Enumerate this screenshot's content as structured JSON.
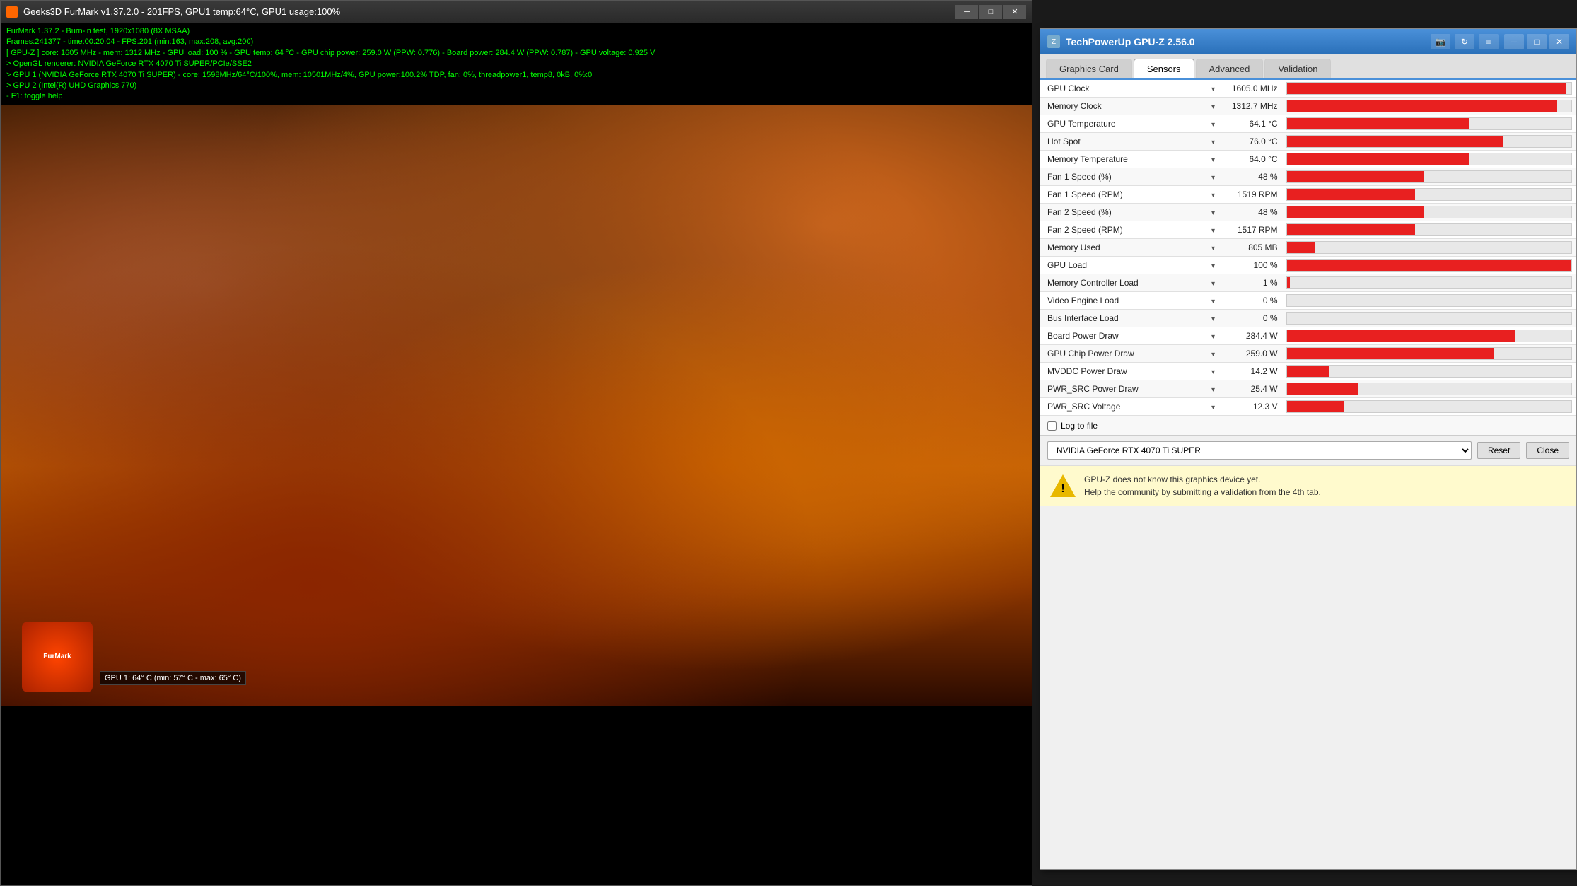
{
  "furmark": {
    "title": "Geeks3D FurMark v1.37.2.0 - 201FPS, GPU1 temp:64°C, GPU1 usage:100%",
    "info_lines": [
      "FurMark 1.37.2 - Burn-in test, 1920x1080 (8X MSAA)",
      "Frames:241377 - time:00:20:04 - FPS:201 (min:163, max:208, avg:200)",
      "[ GPU-Z ] core: 1605 MHz - mem: 1312 MHz - GPU load: 100 % - GPU temp: 64 °C - GPU chip power: 259.0 W (PPW: 0.776) - Board power: 284.4 W (PPW: 0.787) - GPU voltage: 0.925 V",
      "> OpenGL renderer: NVIDIA GeForce RTX 4070 Ti SUPER/PCIe/SSE2",
      "> GPU 1 (NVIDIA GeForce RTX 4070 Ti SUPER) - core: 1598MHz/64°C/100%, mem: 10501MHz/4%, GPU power:100.2% TDP, fan: 0%, threadpower1, temp8, 0kB, 0%:0",
      "> GPU 2 (Intel(R) UHD Graphics 770)",
      "- F1: toggle help"
    ],
    "gpu_temp_label": "GPU 1: 64° C (min: 57° C - max: 65° C)",
    "logo_text": "FurMark"
  },
  "gpuz": {
    "title": "TechPowerUp GPU-Z 2.56.0",
    "tabs": [
      {
        "label": "Graphics Card",
        "active": false
      },
      {
        "label": "Sensors",
        "active": true
      },
      {
        "label": "Advanced",
        "active": false
      },
      {
        "label": "Validation",
        "active": false
      }
    ],
    "sensors": [
      {
        "name": "GPU Clock",
        "value": "1605.0 MHz",
        "bar_pct": 98
      },
      {
        "name": "Memory Clock",
        "value": "1312.7 MHz",
        "bar_pct": 95
      },
      {
        "name": "GPU Temperature",
        "value": "64.1 °C",
        "bar_pct": 64
      },
      {
        "name": "Hot Spot",
        "value": "76.0 °C",
        "bar_pct": 76
      },
      {
        "name": "Memory Temperature",
        "value": "64.0 °C",
        "bar_pct": 64
      },
      {
        "name": "Fan 1 Speed (%)",
        "value": "48 %",
        "bar_pct": 48
      },
      {
        "name": "Fan 1 Speed (RPM)",
        "value": "1519 RPM",
        "bar_pct": 45
      },
      {
        "name": "Fan 2 Speed (%)",
        "value": "48 %",
        "bar_pct": 48
      },
      {
        "name": "Fan 2 Speed (RPM)",
        "value": "1517 RPM",
        "bar_pct": 45
      },
      {
        "name": "Memory Used",
        "value": "805 MB",
        "bar_pct": 10
      },
      {
        "name": "GPU Load",
        "value": "100 %",
        "bar_pct": 100
      },
      {
        "name": "Memory Controller Load",
        "value": "1 %",
        "bar_pct": 1
      },
      {
        "name": "Video Engine Load",
        "value": "0 %",
        "bar_pct": 0
      },
      {
        "name": "Bus Interface Load",
        "value": "0 %",
        "bar_pct": 0
      },
      {
        "name": "Board Power Draw",
        "value": "284.4 W",
        "bar_pct": 80
      },
      {
        "name": "GPU Chip Power Draw",
        "value": "259.0 W",
        "bar_pct": 73
      },
      {
        "name": "MVDDC Power Draw",
        "value": "14.2 W",
        "bar_pct": 15
      },
      {
        "name": "PWR_SRC Power Draw",
        "value": "25.4 W",
        "bar_pct": 25
      },
      {
        "name": "PWR_SRC Voltage",
        "value": "12.3 V",
        "bar_pct": 20
      }
    ],
    "log_to_file_label": "Log to file",
    "device_name": "NVIDIA GeForce RTX 4070 Ti SUPER",
    "reset_label": "Reset",
    "close_label": "Close",
    "warning_text_line1": "GPU-Z does not know this graphics device yet.",
    "warning_text_line2": "Help the community by submitting a validation from the 4th tab."
  }
}
